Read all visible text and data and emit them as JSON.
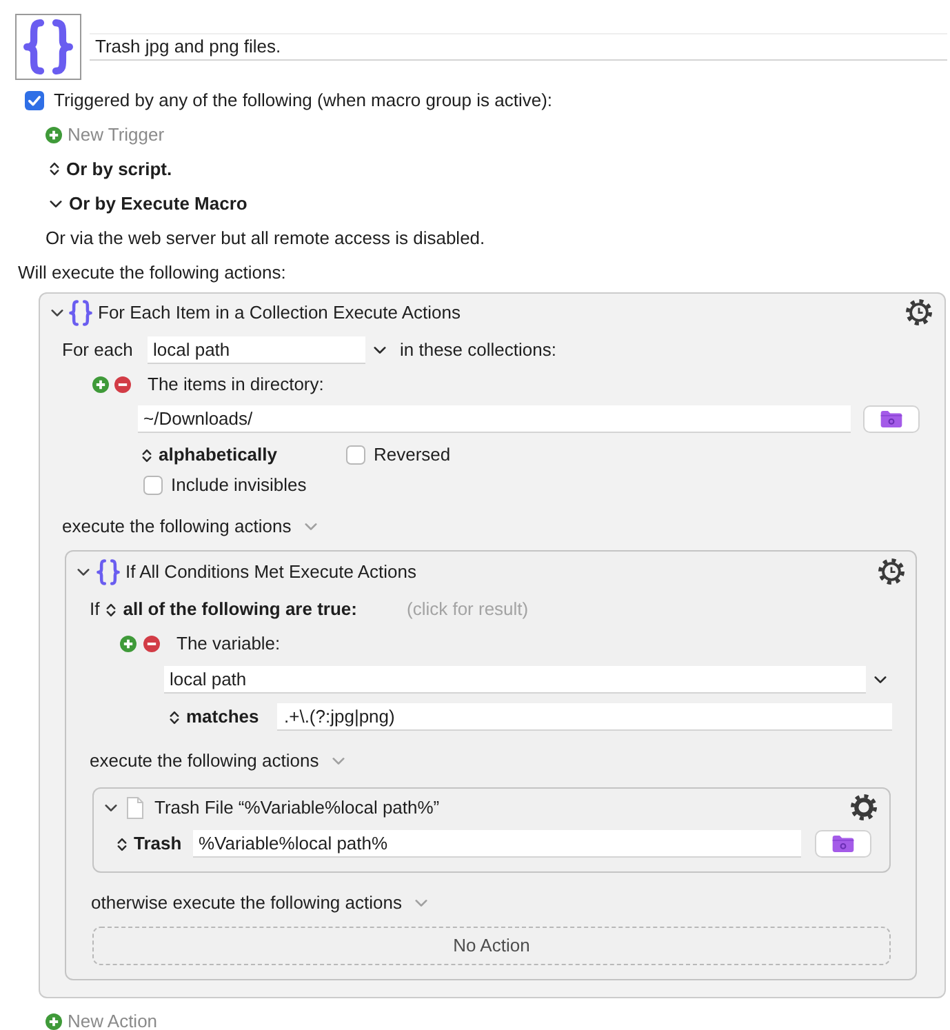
{
  "macro": {
    "name": "Trash jpg and png files."
  },
  "triggers": {
    "enabled": true,
    "label": "Triggered by any of the following (when macro group is active):",
    "new_trigger": "New Trigger",
    "options": [
      {
        "label": "Or by script.",
        "expanded": false
      },
      {
        "label": "Or by Execute Macro",
        "expanded": true
      }
    ],
    "note": "Or via the web server but all remote access is disabled."
  },
  "actions_label": "Will execute the following actions:",
  "action": {
    "title": "For Each Item in a Collection Execute Actions",
    "expanded": true,
    "for_each_label": "For each",
    "variable": "local path",
    "collections_label": "in these collections:",
    "collection": {
      "label": "The items in directory:",
      "path": "~/Downloads/",
      "sort": "alphabetically",
      "reversed": {
        "label": "Reversed",
        "checked": false
      },
      "include_invisibles": {
        "label": "Include invisibles",
        "checked": false
      }
    },
    "body_label": "execute the following actions",
    "actions": [
      {
        "kind": "if",
        "title": "If All Conditions Met Execute Actions",
        "expanded": true,
        "if_label": "If",
        "mode": "all of the following are true:",
        "result_hint": "(click for result)",
        "conditions": [
          {
            "label": "The variable:",
            "variable": "local path",
            "operator": "matches",
            "value": ".+\\.(?:jpg|png)"
          }
        ],
        "then_label": "execute the following actions",
        "then_actions": [
          {
            "kind": "trash",
            "title": "Trash File “%Variable%local path%”",
            "expanded": true,
            "operation": "Trash",
            "path": "%Variable%local path%"
          }
        ],
        "else_label": "otherwise execute the following actions",
        "else_placeholder": "No Action"
      }
    ]
  },
  "new_action": "New Action"
}
